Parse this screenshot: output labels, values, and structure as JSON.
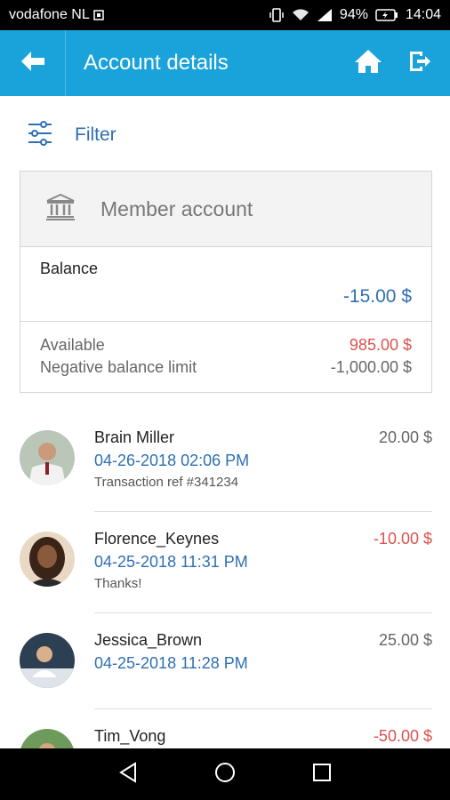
{
  "status_bar": {
    "carrier": "vodafone NL",
    "battery": "94%",
    "time": "14:04"
  },
  "app_bar": {
    "title": "Account details"
  },
  "filter": {
    "label": "Filter"
  },
  "account": {
    "name": "Member account",
    "balance_label": "Balance",
    "balance_value": "-15.00 $",
    "available_label": "Available",
    "available_value": "985.00 $",
    "limit_label": "Negative balance limit",
    "limit_value": "-1,000.00 $"
  },
  "transactions": [
    {
      "name": "Brain Miller",
      "date": "04-26-2018 02:06 PM",
      "desc": "Transaction ref #341234",
      "amount": "20.00 $",
      "negative": false
    },
    {
      "name": "Florence_Keynes",
      "date": "04-25-2018 11:31 PM",
      "desc": "Thanks!",
      "amount": "-10.00 $",
      "negative": true
    },
    {
      "name": "Jessica_Brown",
      "date": "04-25-2018 11:28 PM",
      "desc": "",
      "amount": "25.00 $",
      "negative": false
    },
    {
      "name": "Tim_Vong",
      "date": "",
      "desc": "",
      "amount": "-50.00 $",
      "negative": true
    }
  ],
  "colors": {
    "accent": "#1aa3db",
    "link_blue": "#2f6fb3",
    "negative_red": "#d9534f"
  },
  "icons": {
    "back": "arrow-left-icon",
    "home": "home-icon",
    "logout": "logout-icon",
    "filter": "sliders-icon",
    "bank": "bank-icon"
  }
}
